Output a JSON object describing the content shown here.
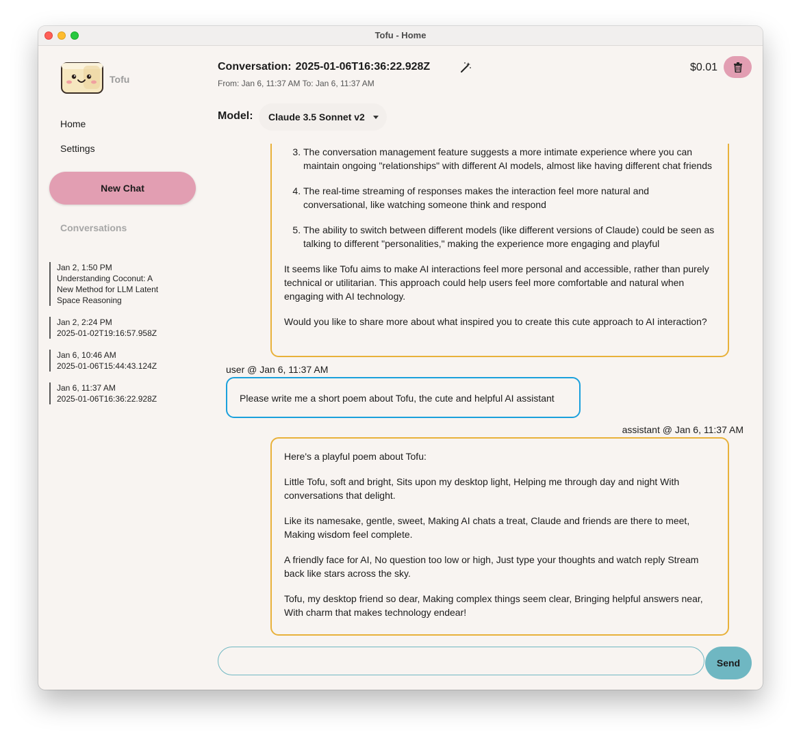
{
  "window": {
    "title": "Tofu - Home"
  },
  "sidebar": {
    "app_name": "Tofu",
    "nav": [
      {
        "label": "Home"
      },
      {
        "label": "Settings"
      }
    ],
    "new_chat_label": "New Chat",
    "conversations_heading": "Conversations",
    "conversations": [
      {
        "time": "Jan 2, 1:50 PM",
        "title": "Understanding Coconut: A New Method for LLM Latent Space Reasoning"
      },
      {
        "time": "Jan 2, 2:24 PM",
        "title": "2025-01-02T19:16:57.958Z"
      },
      {
        "time": "Jan 6, 10:46 AM",
        "title": "2025-01-06T15:44:43.124Z"
      },
      {
        "time": "Jan 6, 11:37 AM",
        "title": "2025-01-06T16:36:22.928Z"
      }
    ]
  },
  "header": {
    "conversation_label": "Conversation:",
    "conversation_id": "2025-01-06T16:36:22.928Z",
    "dates": "From: Jan 6, 11:37 AM To: Jan 6, 11:37 AM",
    "cost": "$0.01",
    "model_label": "Model:",
    "model_selected": "Claude 3.5 Sonnet v2"
  },
  "messages": {
    "prev_assistant": {
      "list_items": [
        "The conversation management feature suggests a more intimate experience where you can maintain ongoing \"relationships\" with different AI models, almost like having different chat friends",
        "The real-time streaming of responses makes the interaction feel more natural and conversational, like watching someone think and respond",
        "The ability to switch between different models (like different versions of Claude) could be seen as talking to different \"personalities,\" making the experience more engaging and playful"
      ],
      "paragraphs": [
        "It seems like Tofu aims to make AI interactions feel more personal and accessible, rather than purely technical or utilitarian. This approach could help users feel more comfortable and natural when engaging with AI technology.",
        "Would you like to share more about what inspired you to create this cute approach to AI interaction?"
      ]
    },
    "user": {
      "meta": "user @ Jan 6, 11:37 AM",
      "text": "Please write me a short poem about Tofu, the cute and helpful AI assistant"
    },
    "assistant": {
      "meta": "assistant @ Jan 6, 11:37 AM",
      "paragraphs": [
        "Here's a playful poem about Tofu:",
        "Little Tofu, soft and bright, Sits upon my desktop light, Helping me through day and night With conversations that delight.",
        "Like its namesake, gentle, sweet, Making AI chats a treat, Claude and friends are there to meet, Making wisdom feel complete.",
        "A friendly face for AI, No question too low or high, Just type your thoughts and watch reply Stream back like stars across the sky.",
        "Tofu, my desktop friend so dear, Making complex things seem clear, Bringing helpful answers near, With charm that makes technology endear!"
      ]
    }
  },
  "composer": {
    "placeholder": "",
    "send_label": "Send"
  },
  "colors": {
    "accent_pink": "#e29eb2",
    "assistant_border": "#e8b13a",
    "user_border": "#1aa0dc",
    "send_teal": "#6fb7c2",
    "background": "#f8f4f1"
  }
}
